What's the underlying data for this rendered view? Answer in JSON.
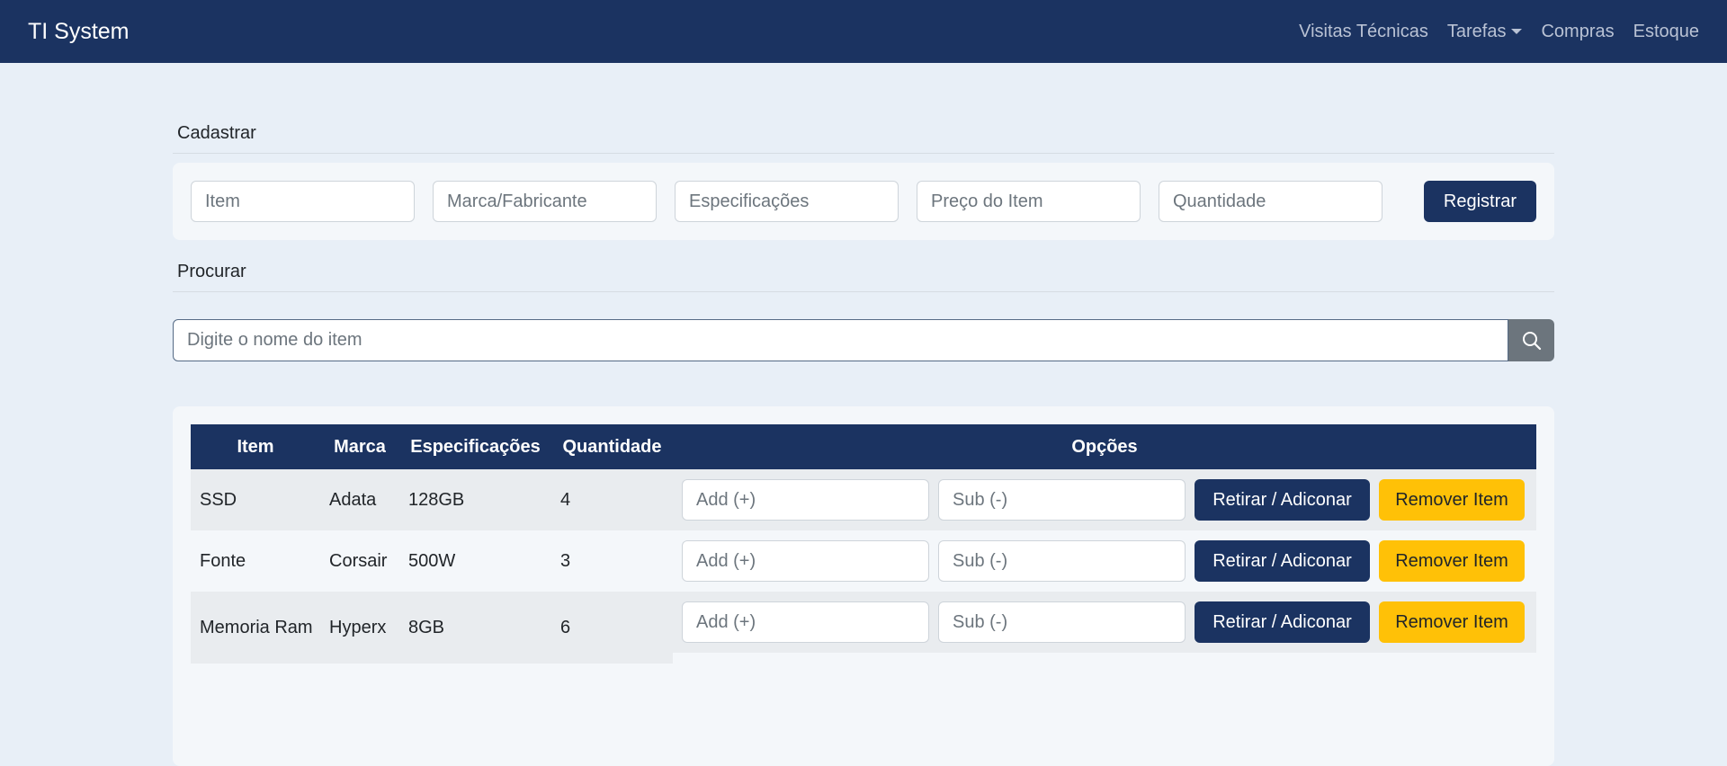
{
  "navbar": {
    "brand": "TI System",
    "links": [
      "Visitas Técnicas",
      "Tarefas",
      "Compras",
      "Estoque"
    ]
  },
  "register": {
    "title": "Cadastrar",
    "placeholders": [
      "Item",
      "Marca/Fabricante",
      "Especificações",
      "Preço do Item",
      "Quantidade"
    ],
    "button": "Registrar"
  },
  "search": {
    "title": "Procurar",
    "placeholder": "Digite o nome do item",
    "icon": "search-icon"
  },
  "table": {
    "headers": [
      "Item",
      "Marca",
      "Especificações",
      "Quantidade",
      "Opções"
    ],
    "add_placeholder": "Add (+)",
    "sub_placeholder": "Sub (-)",
    "retirar_label": "Retirar / Adiconar",
    "remover_label": "Remover Item",
    "rows": [
      {
        "item": "SSD",
        "marca": "Adata",
        "spec": "128GB",
        "qty": "4"
      },
      {
        "item": "Fonte",
        "marca": "Corsair",
        "spec": "500W",
        "qty": "3"
      },
      {
        "item": "Memoria Ram",
        "marca": "Hyperx",
        "spec": "8GB",
        "qty": "6"
      }
    ]
  },
  "colors": {
    "navbar": "#1b3361",
    "background": "#e8eff7",
    "primary": "#1b3361",
    "warning": "#ffc107"
  }
}
